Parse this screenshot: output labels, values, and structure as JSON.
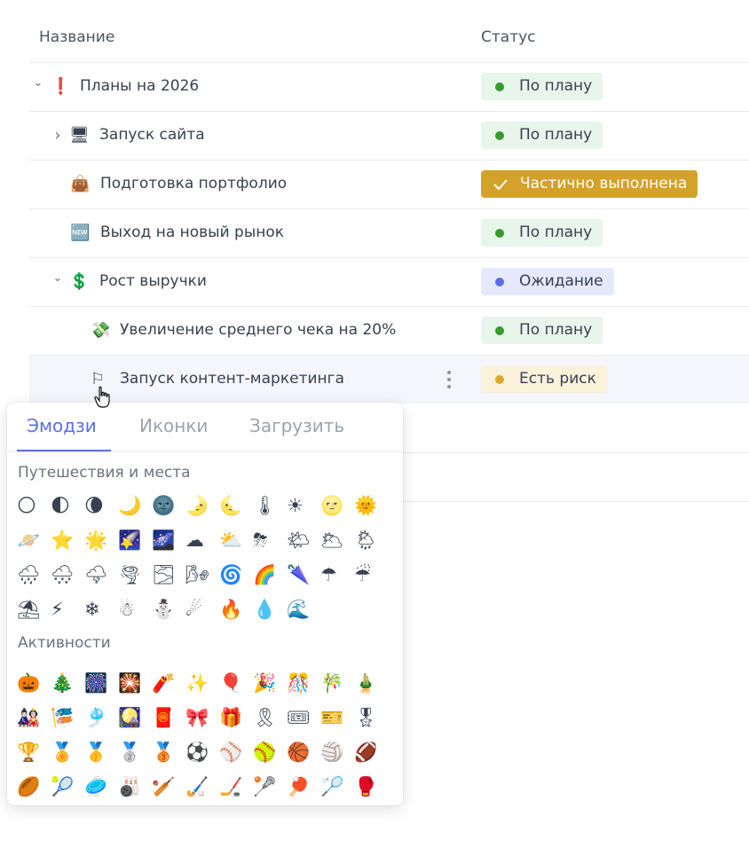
{
  "table": {
    "columns": {
      "name": "Название",
      "status": "Статус"
    },
    "rows": [
      {
        "name": "Планы на 2026",
        "icon": "❗",
        "icon_name": "exclamation-icon",
        "caret": "⌄",
        "status": "По плану",
        "status_kind": "green"
      },
      {
        "name": "Запуск сайта",
        "icon": "🖥",
        "icon_name": "monitor-icon",
        "caret": "›",
        "status": "По плану",
        "status_kind": "green"
      },
      {
        "name": "Подготовка портфолио",
        "icon": "👜",
        "icon_name": "handbag-icon",
        "caret": "",
        "status": "Частично выполнена",
        "status_kind": "done"
      },
      {
        "name": "Выход на новый рынок",
        "icon": "🆕",
        "icon_name": "new-button-icon",
        "caret": "",
        "status": "По плану",
        "status_kind": "green"
      },
      {
        "name": "Рост выручки",
        "icon": "💲",
        "icon_name": "dollar-icon",
        "caret": "⌄",
        "status": "Ожидание",
        "status_kind": "blue"
      },
      {
        "name": "Увеличение среднего чека на 20%",
        "icon": "💸",
        "icon_name": "money-icon",
        "caret": "",
        "status": "По плану",
        "status_kind": "green"
      },
      {
        "name": "Запуск контент-маркетинга",
        "icon": "⚐",
        "icon_name": "flag-icon",
        "caret": "",
        "status": "Есть риск",
        "status_kind": "yellow"
      }
    ]
  },
  "colors": {
    "accent": "#5b6ee6",
    "green": "#3a9a2f",
    "yellow": "#dcaa2b",
    "done": "#d4a22a"
  },
  "picker": {
    "tabs": [
      "Эмодзи",
      "Иконки",
      "Загрузить"
    ],
    "active_tab": "Эмодзи",
    "sections": [
      {
        "title": "Путешествия и места",
        "emojis": [
          "🌕",
          "🌓",
          "🌘",
          "🌙",
          "🌚",
          "🌛",
          "🌜",
          "🌡",
          "☀",
          "🌝",
          "🌞",
          "🪐",
          "⭐",
          "🌟",
          "🌠",
          "🌌",
          "☁",
          "⛅",
          "⛈",
          "🌤",
          "🌥",
          "🌦",
          "🌧",
          "🌨",
          "🌩",
          "🌪",
          "🌫",
          "🌬",
          "🌀",
          "🌈",
          "🌂",
          "☂",
          "☔",
          "⛱",
          "⚡",
          "❄",
          "☃",
          "⛄",
          "☄",
          "🔥",
          "💧",
          "🌊"
        ]
      },
      {
        "title": "Активности",
        "emojis": [
          "🎃",
          "🎄",
          "🎆",
          "🎇",
          "🧨",
          "✨",
          "🎈",
          "🎉",
          "🎊",
          "🎋",
          "🎍",
          "🎎",
          "🎏",
          "🎐",
          "🎑",
          "🧧",
          "🎀",
          "🎁",
          "🎗",
          "🎟",
          "🎫",
          "🎖",
          "🏆",
          "🏅",
          "🥇",
          "🥈",
          "🥉",
          "⚽",
          "⚾",
          "🥎",
          "🏀",
          "🏐",
          "🏈",
          "🏉",
          "🎾",
          "🥏",
          "🎳",
          "🏏",
          "🏑",
          "🏒",
          "🥍",
          "🏓",
          "🏸",
          "🥊"
        ]
      }
    ]
  }
}
